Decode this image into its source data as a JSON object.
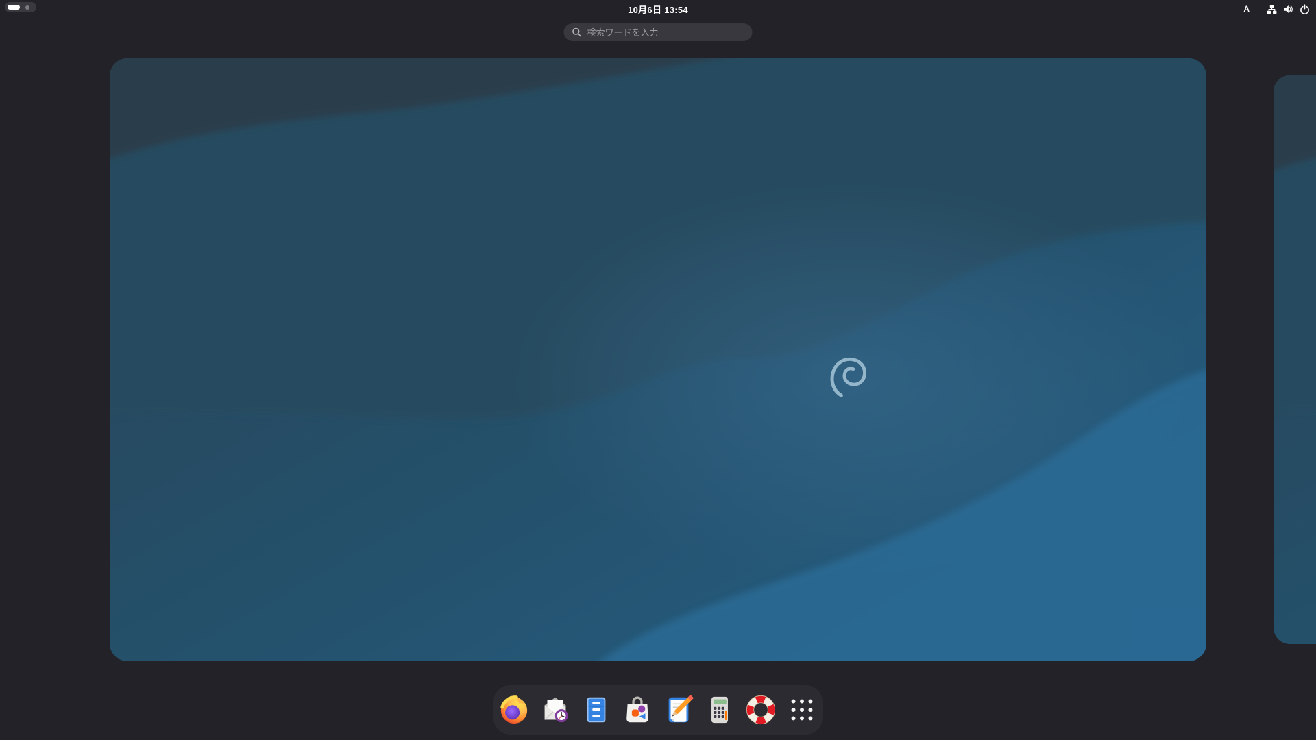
{
  "topbar": {
    "clock": "10月6日 13:54",
    "input_method_indicator": "A",
    "workspace_switcher": {
      "workspace_count": 2,
      "active_workspace": 1
    },
    "status_icons": [
      "network-wired-icon",
      "volume-icon",
      "power-icon"
    ]
  },
  "search": {
    "placeholder": "検索ワードを入力",
    "value": "",
    "icon": "search-icon"
  },
  "overview": {
    "workspaces": [
      {
        "id": 1,
        "active": true,
        "wallpaper": "debian-emerald-waves",
        "logo": "debian-swirl"
      },
      {
        "id": 2,
        "active": false,
        "wallpaper": "debian-emerald-waves"
      }
    ]
  },
  "dock": {
    "items": [
      {
        "icon": "firefox-icon"
      },
      {
        "icon": "evolution-mail-icon"
      },
      {
        "icon": "files-icon"
      },
      {
        "icon": "software-icon"
      },
      {
        "icon": "text-editor-icon"
      },
      {
        "icon": "calculator-icon"
      },
      {
        "icon": "help-icon"
      },
      {
        "icon": "show-apps-icon"
      }
    ]
  },
  "colors": {
    "shell_background": "#232228",
    "dock_background": "#2c2b31",
    "search_background": "#39383e",
    "search_placeholder_text": "#9d9da2",
    "topbar_text": "#ffffff",
    "wallpaper_darkest": "#2c3d4c",
    "wallpaper_dark": "#254b61",
    "wallpaper_base": "#26597a",
    "wallpaper_light": "#2b6b94",
    "debian_swirl": "#b7d3e3"
  }
}
